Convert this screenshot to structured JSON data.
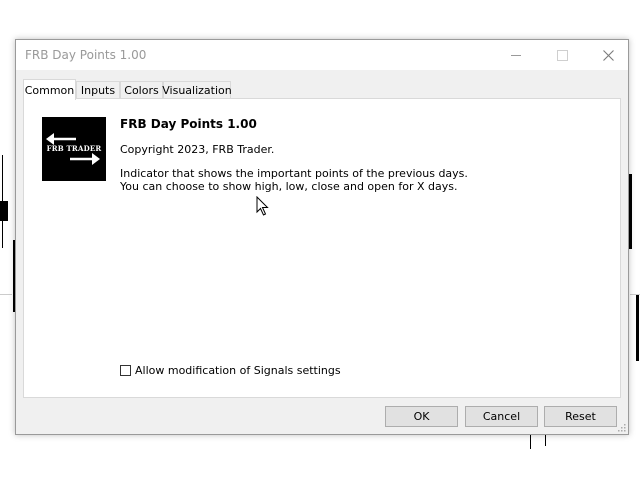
{
  "window": {
    "title": "FRB Day Points 1.00"
  },
  "tabs": [
    {
      "label": "Common"
    },
    {
      "label": "Inputs"
    },
    {
      "label": "Colors"
    },
    {
      "label": "Visualization"
    }
  ],
  "indicator": {
    "name": "FRB Day Points 1.00",
    "copyright": "Copyright 2023, FRB Trader.",
    "description": [
      "Indicator that shows the important points of the previous days.",
      "You can choose to show high, low, close and open for X days."
    ],
    "logo_text": "FRB TRADER"
  },
  "options": {
    "allow_signals_label": "Allow modification of Signals settings"
  },
  "buttons": {
    "ok": "OK",
    "cancel": "Cancel",
    "reset": "Reset"
  },
  "icons": {
    "minimize": "minimize-icon",
    "maximize": "maximize-icon",
    "close": "close-icon",
    "logo_arrows": "exchange-arrows-icon",
    "cursor": "mouse-pointer-icon"
  },
  "colors": {
    "window_bg": "#f0f0f0",
    "panel_bg": "#ffffff",
    "logo_bg": "#000000",
    "title_text": "#999999"
  }
}
